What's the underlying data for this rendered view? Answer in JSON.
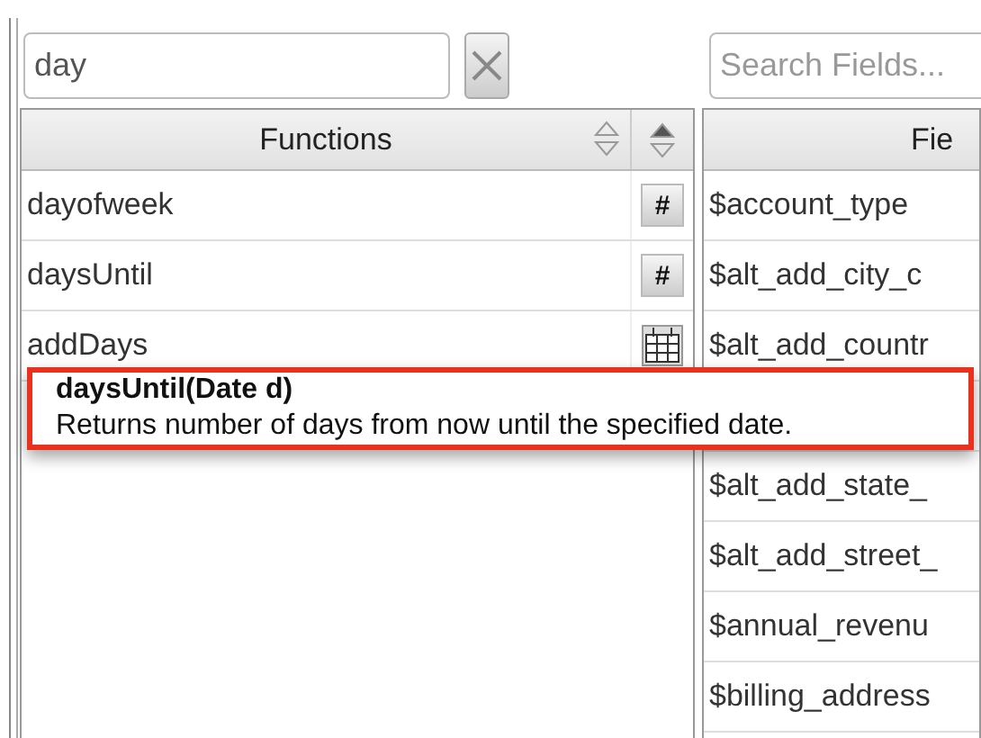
{
  "function_search": {
    "value": "day"
  },
  "field_search": {
    "placeholder": "Search Fields..."
  },
  "functions_table": {
    "columns": [
      "Functions"
    ],
    "type_sorted_ascending": true,
    "rows": [
      {
        "name": "dayofweek",
        "kind": "number",
        "type_label": "#"
      },
      {
        "name": "daysUntil",
        "kind": "number",
        "type_label": "#"
      },
      {
        "name": "addDays",
        "kind": "date"
      }
    ]
  },
  "fields_table": {
    "columns": [
      "Fie"
    ],
    "rows": [
      "$account_type",
      "$alt_add_city_c",
      "$alt_add_countr",
      "$alt_add_state_",
      "$alt_add_street_",
      "$annual_revenu",
      "$billing_address"
    ]
  },
  "tooltip": {
    "signature": "daysUntil(Date d)",
    "description": "Returns number of days from now until the specified date."
  }
}
